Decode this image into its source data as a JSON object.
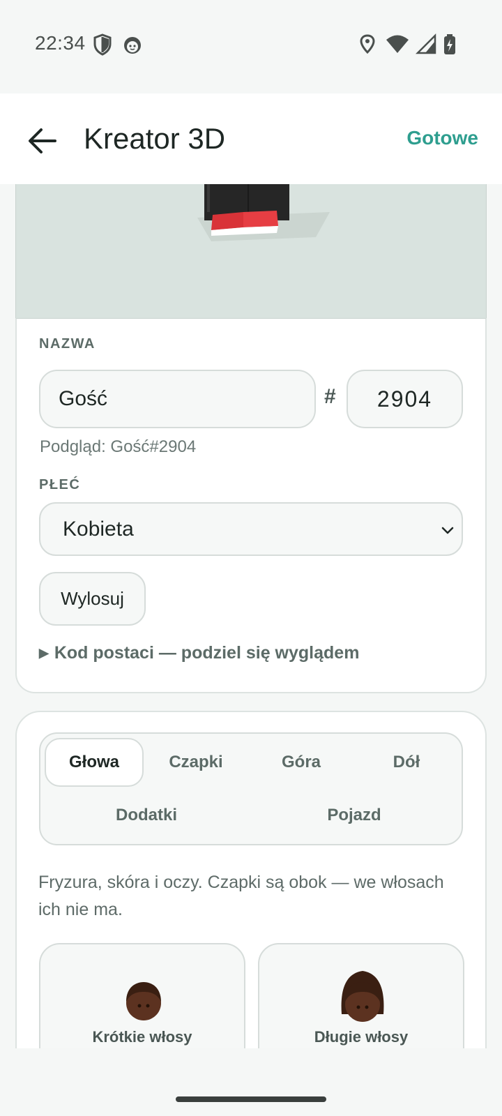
{
  "status_bar": {
    "time": "22:34"
  },
  "app_bar": {
    "title": "Kreator 3D",
    "done_label": "Gotowe"
  },
  "name_section": {
    "label": "NAZWA",
    "name_value": "Gość",
    "hash": "#",
    "tag_value": "2904",
    "preview_text": "Podgląd: Gość#2904"
  },
  "gender_section": {
    "label": "PŁEĆ",
    "selected": "Kobieta"
  },
  "random_label": "Wylosuj",
  "code_toggle_label": "Kod postaci — podziel się wyglądem",
  "tabs": [
    {
      "label": "Głowa",
      "active": true
    },
    {
      "label": "Czapki",
      "active": false
    },
    {
      "label": "Góra",
      "active": false
    },
    {
      "label": "Dół",
      "active": false
    },
    {
      "label": "Dodatki",
      "active": false
    },
    {
      "label": "Pojazd",
      "active": false
    }
  ],
  "hint_text": "Fryzura, skóra i oczy. Czapki są obok — we włosach ich nie ma.",
  "options": [
    {
      "label": "Krótkie włosy"
    },
    {
      "label": "Długie włosy"
    }
  ],
  "colors": {
    "accent": "#2e9e8f",
    "skin": "#5c3220",
    "hair": "#3a1f12",
    "shoe": "#e03a3e"
  }
}
